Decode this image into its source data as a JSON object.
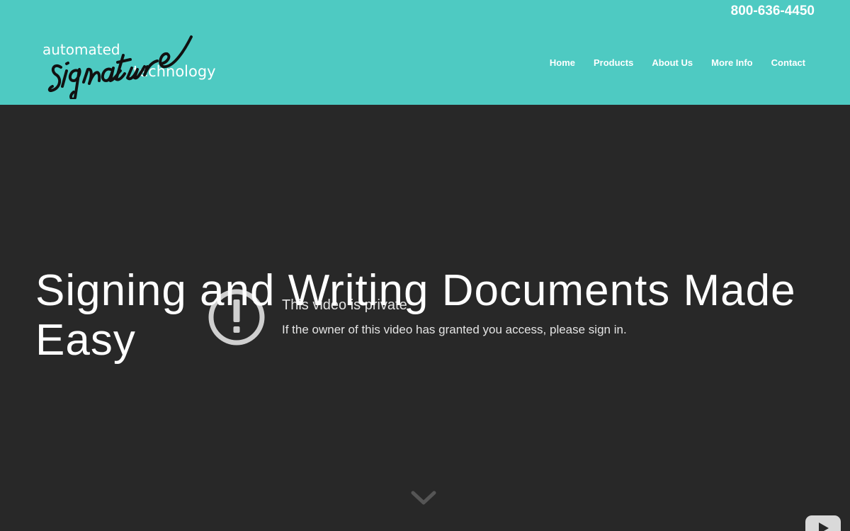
{
  "header": {
    "phone": "800-636-4450",
    "logo": {
      "line1": "automated",
      "line2": "signature",
      "line3": "technology"
    },
    "nav": [
      {
        "label": "Home"
      },
      {
        "label": "Products"
      },
      {
        "label": "About Us"
      },
      {
        "label": "More Info"
      },
      {
        "label": "Contact"
      }
    ]
  },
  "hero": {
    "title": "Signing and Writing Documents Made Easy",
    "video": {
      "error_title": "This video is private",
      "error_message": "If the owner of this video has granted you access, please sign in."
    }
  },
  "icons": {
    "scroll": "chevron-down-icon",
    "video_error": "exclamation-circle-icon",
    "player": "youtube-play-icon"
  },
  "colors": {
    "header_bg": "#4ecac2",
    "hero_bg": "#282828",
    "text": "#ffffff"
  }
}
